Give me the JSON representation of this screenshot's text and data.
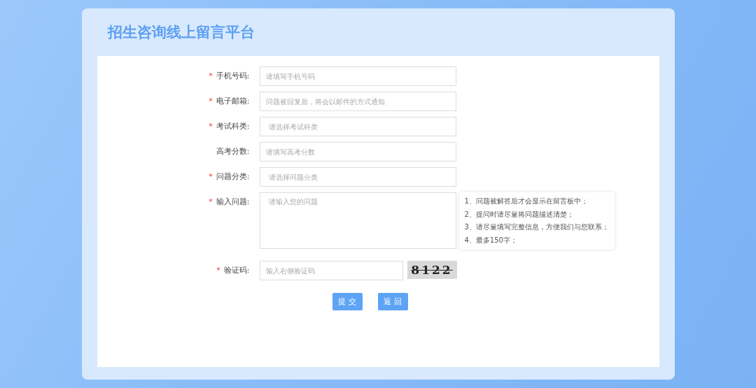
{
  "title": "招生咨询线上留言平台",
  "required_mark": "*",
  "fields": [
    {
      "label": "手机号码:",
      "required": true,
      "kind": "text",
      "placeholder": "请填写手机号码"
    },
    {
      "label": "电子邮箱:",
      "required": true,
      "kind": "text",
      "placeholder": "问题被回复后，将会以邮件的方式通知"
    },
    {
      "label": "考试科类:",
      "required": true,
      "kind": "select",
      "placeholder": "请选择考试科类"
    },
    {
      "label": "高考分数:",
      "required": false,
      "kind": "text",
      "placeholder": "请填写高考分数"
    },
    {
      "label": "问题分类:",
      "required": true,
      "kind": "select",
      "placeholder": "请选择问题分类"
    },
    {
      "label": "输入问题:",
      "required": true,
      "kind": "textarea",
      "placeholder": "请输入您的问题",
      "tips": [
        "1、问题被解答后才会显示在留言板中；",
        "2、提问时请尽量将问题描述清楚；",
        "3、请尽量填写完整信息，方便我们与您联系；",
        "4、最多150字；"
      ]
    },
    {
      "label": "验证码:",
      "required": true,
      "kind": "captcha",
      "placeholder": "输入右侧验证码",
      "captcha": "8122"
    }
  ],
  "buttons": [
    "提 交",
    "返 回"
  ]
}
